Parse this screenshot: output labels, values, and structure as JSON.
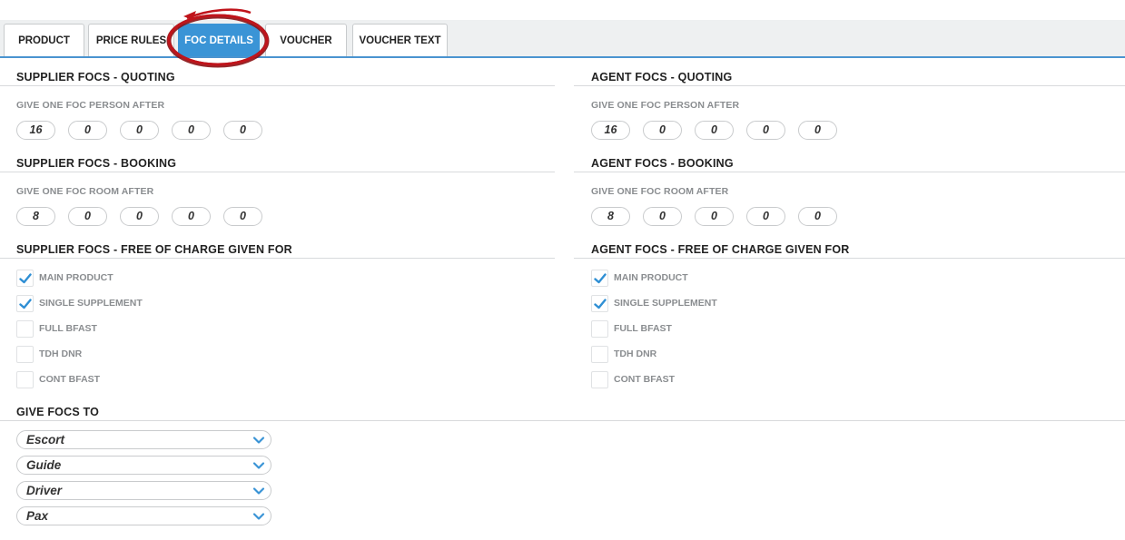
{
  "tabs": [
    {
      "label": "PRODUCT"
    },
    {
      "label": "PRICE RULES"
    },
    {
      "label": "FOC DETAILS",
      "active": true
    },
    {
      "label": "VOUCHER"
    },
    {
      "label": "VOUCHER TEXT"
    }
  ],
  "supplier": {
    "quoting": {
      "title": "SUPPLIER FOCS - QUOTING",
      "label": "GIVE ONE FOC PERSON AFTER",
      "values": [
        "16",
        "0",
        "0",
        "0",
        "0"
      ]
    },
    "booking": {
      "title": "SUPPLIER FOCS - BOOKING",
      "label": "GIVE ONE FOC ROOM AFTER",
      "values": [
        "8",
        "0",
        "0",
        "0",
        "0"
      ]
    },
    "free_of_charge": {
      "title": "SUPPLIER FOCS - FREE OF CHARGE GIVEN FOR",
      "items": [
        {
          "label": "MAIN PRODUCT",
          "checked": true
        },
        {
          "label": "SINGLE SUPPLEMENT",
          "checked": true
        },
        {
          "label": "FULL BFAST",
          "checked": false
        },
        {
          "label": "TDH DNR",
          "checked": false
        },
        {
          "label": "CONT BFAST",
          "checked": false
        }
      ]
    }
  },
  "agent": {
    "quoting": {
      "title": "AGENT FOCS - QUOTING",
      "label": "GIVE ONE FOC PERSON AFTER",
      "values": [
        "16",
        "0",
        "0",
        "0",
        "0"
      ]
    },
    "booking": {
      "title": "AGENT FOCS - BOOKING",
      "label": "GIVE ONE FOC ROOM AFTER",
      "values": [
        "8",
        "0",
        "0",
        "0",
        "0"
      ]
    },
    "free_of_charge": {
      "title": "AGENT FOCS - FREE OF CHARGE GIVEN FOR",
      "items": [
        {
          "label": "MAIN PRODUCT",
          "checked": true
        },
        {
          "label": "SINGLE SUPPLEMENT",
          "checked": true
        },
        {
          "label": "FULL BFAST",
          "checked": false
        },
        {
          "label": "TDH DNR",
          "checked": false
        },
        {
          "label": "CONT BFAST",
          "checked": false
        }
      ]
    }
  },
  "give_focs_to": {
    "title": "GIVE FOCS TO",
    "selects": [
      {
        "value": "Escort"
      },
      {
        "value": "Guide"
      },
      {
        "value": "Driver"
      },
      {
        "value": "Pax"
      }
    ]
  },
  "colors": {
    "accent": "#3a94d6",
    "annotation": "#c0141b"
  },
  "icons": {
    "checkmark": "check-icon",
    "dropdown": "chevron-down-icon"
  }
}
